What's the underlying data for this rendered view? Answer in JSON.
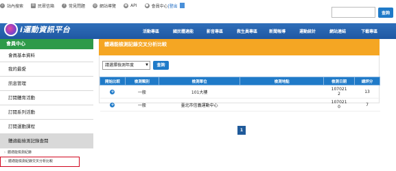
{
  "utility": {
    "items": [
      {
        "icon": "search-icon",
        "label": "站內搜索"
      },
      {
        "icon": "mail-icon",
        "label": "民眾信箱"
      },
      {
        "icon": "question-icon",
        "label": "常見問題"
      },
      {
        "icon": "globe-icon",
        "label": "網站導覽"
      },
      {
        "icon": "api-icon",
        "label": "API"
      },
      {
        "icon": "user-icon",
        "label": "會員中心"
      }
    ],
    "logout": "|登出",
    "search_button": "查詢"
  },
  "nav": {
    "logo_text": "i運動資訊平台",
    "items": [
      "活動專區",
      "國民體適能",
      "影音專區",
      "救生員專區",
      "新聞報導",
      "運動統計",
      "網站連結",
      "下載專區"
    ]
  },
  "sidebar": {
    "header": "會員中心",
    "items": [
      "會員基本資料",
      "我的最愛",
      "訊息管理",
      "訂閱體育活動",
      "訂閱系列活動",
      "訂閱運動課程",
      "體適能檢測記錄查閱"
    ],
    "subitems": [
      "體適能檢測紀錄",
      "體適能檢測紀錄交叉分析比較"
    ]
  },
  "main": {
    "title": "體適能檢測記錄交叉分析比較",
    "select_value": "請選擇檢測年度",
    "query_button": "查詢",
    "columns": [
      "開始比較",
      "檢測類別",
      "檢測單位",
      "檢測地點",
      "檢測日期",
      "總評分"
    ],
    "rows": [
      {
        "category": "一般",
        "unit": "101大樓",
        "location": "",
        "date": [
          "107021",
          "2"
        ],
        "score": "13"
      },
      {
        "category": "一般",
        "unit": "臺北市信義運動中心",
        "location": "",
        "date": [
          "107021",
          "0"
        ],
        "score": "7"
      }
    ],
    "page": "1"
  },
  "colors": {
    "nav": "#1f58a3",
    "sidebar_header": "#2e9a49",
    "title_bar": "#f5a623",
    "table_header": "#1f7ac8",
    "highlight": "#d0021b"
  }
}
